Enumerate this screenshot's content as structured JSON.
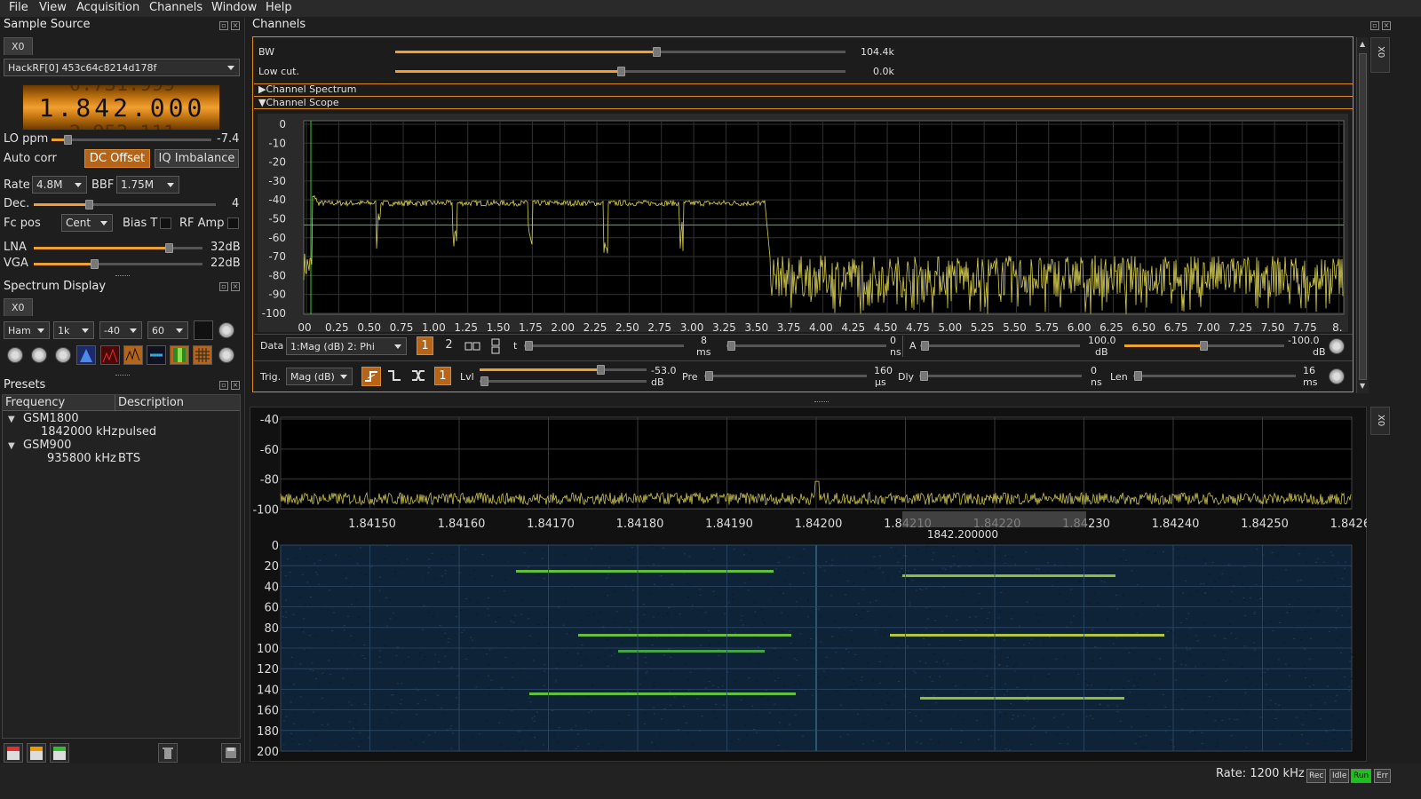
{
  "menu": [
    "File",
    "View",
    "Acquisition",
    "Channels",
    "Window",
    "Help"
  ],
  "sample_source": {
    "title": "Sample Source",
    "tab": "X0",
    "device": "HackRF[0] 453c64c8214d178f",
    "frequency": "1.842.000",
    "freq_ghost_top": "0.731.999",
    "freq_ghost_bottom": "2.953.111",
    "lo_ppm_label": "LO ppm",
    "lo_ppm_value": "-7.4",
    "lo_ppm_fraction": 0.1,
    "autocorr_label": "Auto corr",
    "dc_offset": "DC Offset",
    "iq_imbalance": "IQ Imbalance",
    "rate_label": "Rate",
    "rate_value": "4.8M",
    "bbf_label": "BBF",
    "bbf_value": "1.75M",
    "dec_label": "Dec.",
    "dec_value": "4",
    "dec_fraction": 0.3,
    "fcpos_label": "Fc pos",
    "fcpos_value": "Cent",
    "biast_label": "Bias T",
    "rfamp_label": "RF Amp",
    "lna_label": "LNA",
    "lna_value": "32dB",
    "lna_fraction": 0.8,
    "vga_label": "VGA",
    "vga_value": "22dB",
    "vga_fraction": 0.36
  },
  "spectrum_display": {
    "title": "Spectrum Display",
    "tab": "X0",
    "window": "Ham",
    "fft_size": "1k",
    "ref_level": "-40",
    "range": "60"
  },
  "presets": {
    "title": "Presets",
    "col_frequency": "Frequency",
    "col_description": "Description",
    "groups": [
      {
        "name": "GSM1800",
        "freq": "1842000 kHz",
        "desc": "pulsed"
      },
      {
        "name": "GSM900",
        "freq": "935800 kHz",
        "desc": "BTS"
      }
    ]
  },
  "channels": {
    "title": "Channels",
    "bw_label": "BW",
    "bw_value": "104.4k",
    "bw_fraction": 0.58,
    "lowcut_label": "Low cut.",
    "lowcut_value": "0.0k",
    "lowcut_fraction": 0.5,
    "spectrum_section": "Channel Spectrum",
    "scope_section": "Channel Scope",
    "scope": {
      "y_ticks": [
        "0",
        "-10",
        "-20",
        "-30",
        "-40",
        "-50",
        "-60",
        "-70",
        "-80",
        "-90",
        "-100"
      ],
      "x_ticks": [
        "00",
        "0.25",
        "0.50",
        "0.75",
        "1.00",
        "1.25",
        "1.50",
        "1.75",
        "2.00",
        "2.25",
        "2.50",
        "2.75",
        "3.00",
        "3.25",
        "3.50",
        "3.75",
        "4.00",
        "4.25",
        "4.50",
        "4.75",
        "5.00",
        "5.25",
        "5.50",
        "5.75",
        "6.00",
        "6.25",
        "6.50",
        "6.75",
        "7.00",
        "7.25",
        "7.50",
        "7.75",
        "8."
      ],
      "trace_color": "#d8d050"
    },
    "data_label": "Data",
    "data_select": "1:Mag (dB) 2: Phi",
    "trace1": "1",
    "trace2": "2",
    "t_label": "t",
    "t_value": "8",
    "t_unit": "ms",
    "ofs_value": "0",
    "ofs_unit": "ns",
    "amp_label": "A",
    "amp_value": "100.0",
    "amp_unit": "dB",
    "amp_ofs_value": "-100.0",
    "amp_ofs_unit": "dB",
    "trig_label": "Trig.",
    "trig_select": "Mag (dB)",
    "trig_count": "1",
    "lvl_label": "Lvl",
    "lvl_value": "-53.0",
    "lvl_unit": "dB",
    "pre_label": "Pre",
    "pre_value": "160",
    "pre_unit": "µs",
    "dly_label": "Dly",
    "dly_value": "0",
    "dly_unit": "ns",
    "len_label": "Len",
    "len_value": "16",
    "len_unit": "ms"
  },
  "spectrum": {
    "y_ticks": [
      "-40",
      "-60",
      "-80",
      "-100"
    ],
    "x_ticks": [
      "1.84150",
      "1.84160",
      "1.84170",
      "1.84180",
      "1.84190",
      "1.84200",
      "1.84210",
      "1.84220",
      "1.84230",
      "1.84240",
      "1.84250",
      "1.84260"
    ],
    "center_label": "1842.200000",
    "wf_ticks": [
      "0",
      "20",
      "40",
      "60",
      "80",
      "100",
      "120",
      "140",
      "160",
      "180",
      "200"
    ]
  },
  "side_tabs": {
    "channels": "X0",
    "spectrum": "X0"
  },
  "status": {
    "rate": "Rate: 1200 kHz",
    "rec": "Rec",
    "idle": "Idle",
    "run": "Run",
    "err": "Err",
    "run_color": "#1fbf1f"
  }
}
